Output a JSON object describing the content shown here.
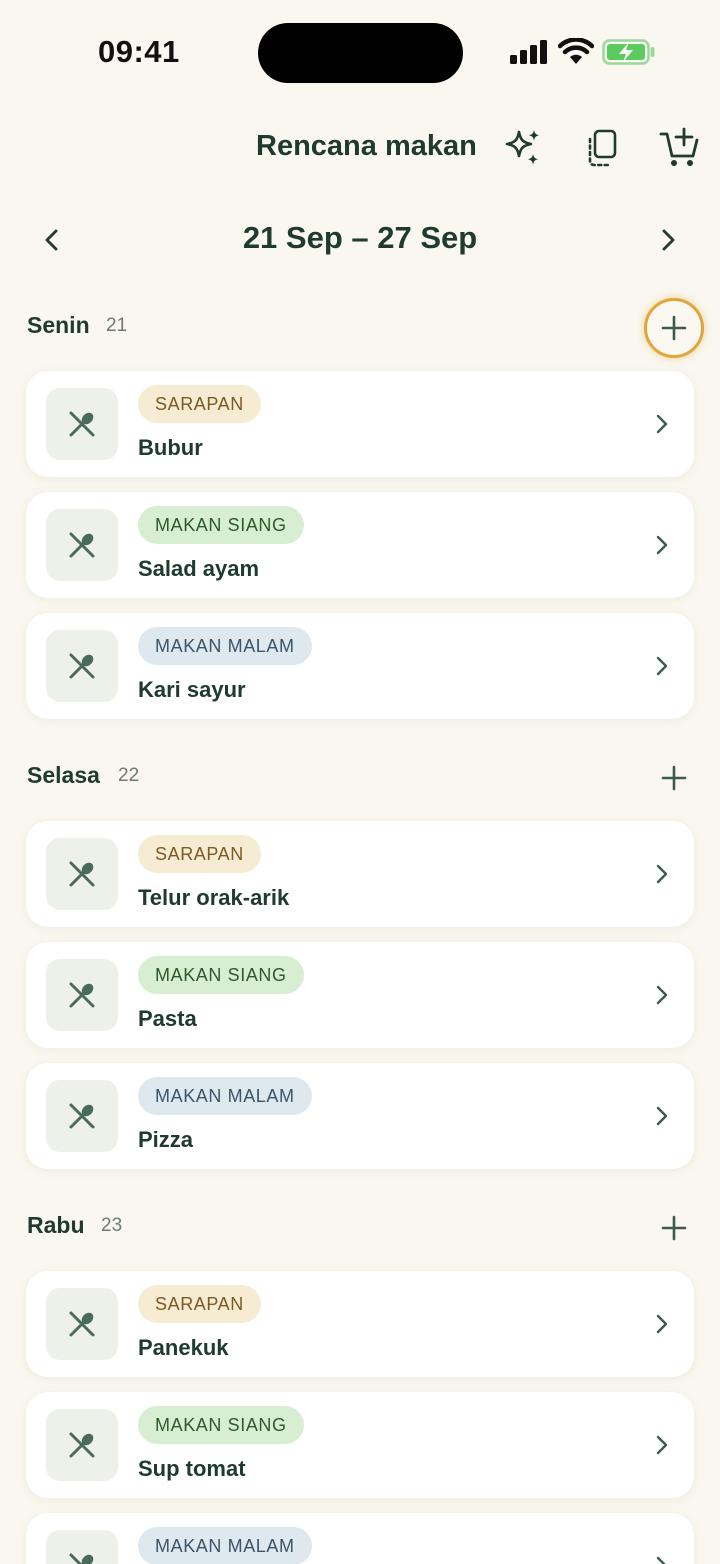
{
  "status_bar": {
    "time": "09:41"
  },
  "header": {
    "title": "Rencana makan",
    "icons": [
      "sparkle-icon",
      "copy-icon",
      "cart-add-icon"
    ]
  },
  "week": {
    "label": "21 Sep – 27 Sep",
    "prev_icon": "chevron-left-icon",
    "next_icon": "chevron-right-icon"
  },
  "days": [
    {
      "name": "Senin",
      "num": "21",
      "meals": [
        {
          "tag": "SARAPAN",
          "type": "breakfast",
          "name": "Bubur"
        },
        {
          "tag": "MAKAN SIANG",
          "type": "lunch",
          "name": "Salad ayam"
        },
        {
          "tag": "MAKAN MALAM",
          "type": "dinner",
          "name": "Kari sayur"
        }
      ]
    },
    {
      "name": "Selasa",
      "num": "22",
      "meals": [
        {
          "tag": "SARAPAN",
          "type": "breakfast",
          "name": "Telur orak-arik"
        },
        {
          "tag": "MAKAN SIANG",
          "type": "lunch",
          "name": "Pasta"
        },
        {
          "tag": "MAKAN MALAM",
          "type": "dinner",
          "name": "Pizza"
        }
      ]
    },
    {
      "name": "Rabu",
      "num": "23",
      "meals": [
        {
          "tag": "SARAPAN",
          "type": "breakfast",
          "name": "Panekuk"
        },
        {
          "tag": "MAKAN SIANG",
          "type": "lunch",
          "name": "Sup tomat"
        },
        {
          "tag": "MAKAN MALAM",
          "type": "dinner",
          "name": ""
        }
      ]
    }
  ],
  "colors": {
    "background": "#f9f7ef",
    "primary_text": "#1f3a2e",
    "highlight_ring": "#e1a53a",
    "battery_green": "#5ccb5f"
  }
}
